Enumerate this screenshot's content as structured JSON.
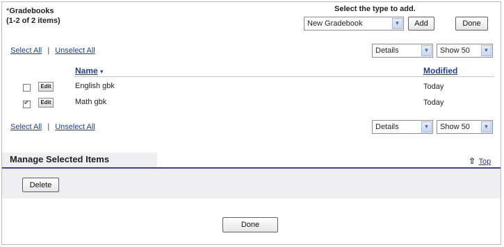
{
  "header": {
    "required_marker": "*",
    "title": "Gradebooks",
    "count": "(1-2 of 2 items)",
    "select_type_label": "Select the type to add.",
    "type_select_value": "New Gradebook",
    "add_label": "Add",
    "done_label": "Done"
  },
  "top_controls": {
    "select_all": "Select All",
    "separator": "|",
    "unselect_all": "Unselect All",
    "view_select": "Details",
    "show_select": "Show 50"
  },
  "table": {
    "col_name": "Name",
    "sort_indicator": "▾",
    "col_modified": "Modified",
    "rows": [
      {
        "checked": false,
        "edit_label": "Edit",
        "name": "English gbk",
        "modified": "Today"
      },
      {
        "checked": true,
        "edit_label": "Edit",
        "name": "Math gbk",
        "modified": "Today"
      }
    ]
  },
  "bottom_controls": {
    "select_all": "Select All",
    "separator": "|",
    "unselect_all": "Unselect All",
    "view_select": "Details",
    "show_select": "Show 50"
  },
  "manage": {
    "title": "Manage Selected Items",
    "top_link": "Top",
    "delete_label": "Delete"
  },
  "footer": {
    "done_label": "Done"
  },
  "colors": {
    "link": "#1c3f95",
    "section_rule": "#3f3fa6",
    "band": "#efeff1"
  },
  "icons": {
    "dropdown": "chevron-down-icon",
    "top": "up-arrow-icon",
    "check": "checkmark-icon"
  }
}
